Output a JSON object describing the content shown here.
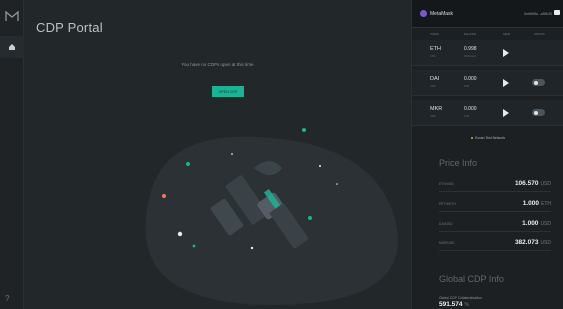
{
  "app": {
    "title": "CDP Portal"
  },
  "main": {
    "empty_message": "You have no CDPs open at this time",
    "open_cdp_label": "OPEN CDP"
  },
  "rail": {
    "help_label": "?"
  },
  "metamask": {
    "name": "MetaMask",
    "address": "0xe86f8a...a55b35"
  },
  "tokens": {
    "headers": [
      "TOKEN",
      "BALANCE",
      "SEND",
      "UNLOCK"
    ],
    "rows": [
      {
        "symbol": "ETH",
        "sub": "USD",
        "balance": "0.998",
        "usd": "99.99 usd"
      },
      {
        "symbol": "DAI",
        "sub": "USD",
        "balance": "0.000",
        "usd": "0.00"
      },
      {
        "symbol": "MKR",
        "sub": "USD",
        "balance": "0.000",
        "usd": "0.00"
      }
    ]
  },
  "network": {
    "label": "Kovan Test Network"
  },
  "price_info": {
    "title": "Price Info",
    "rows": [
      {
        "label": "ETH/USD",
        "value": "106.570",
        "unit": "USD"
      },
      {
        "label": "PETH/ETH",
        "value": "1.000",
        "unit": "ETH"
      },
      {
        "label": "DAI/USD",
        "value": "1.000",
        "unit": "USD"
      },
      {
        "label": "MKR/USD",
        "value": "382.073",
        "unit": "USD"
      }
    ]
  },
  "global_cdp": {
    "title": "Global CDP Info",
    "collateral_label": "Global CDP Collateralization",
    "collateral_value": "591.574",
    "collateral_unit": "%"
  },
  "colors": {
    "accent": "#1ab394",
    "background": "#22272a",
    "panel": "#1c2023"
  }
}
